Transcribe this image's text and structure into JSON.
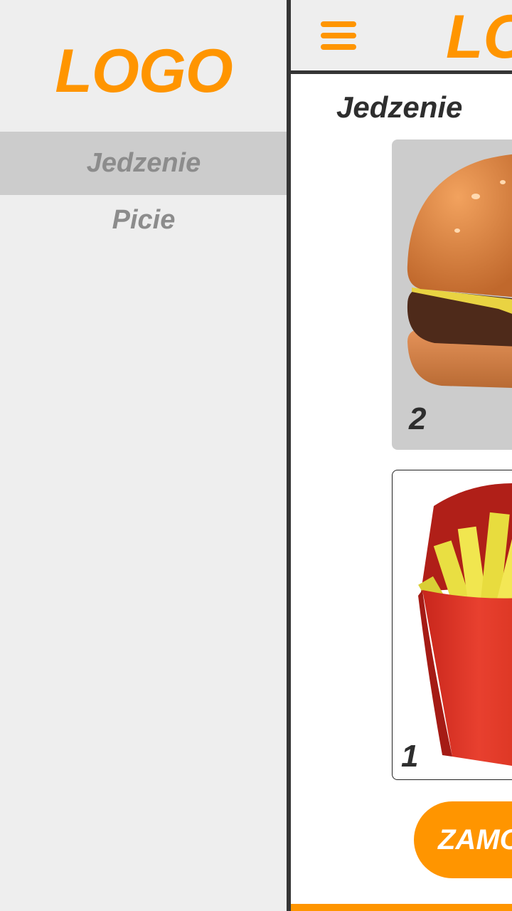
{
  "drawer": {
    "logo": "LOGO",
    "items": [
      {
        "label": "Jedzenie",
        "active": true
      },
      {
        "label": "Picie",
        "active": false
      }
    ]
  },
  "header": {
    "logo": "LO",
    "menu_icon": "hamburger-icon"
  },
  "main": {
    "section_title": "Jedzenie",
    "products": [
      {
        "image": "burger-image",
        "quantity": "2"
      },
      {
        "image": "fries-image",
        "quantity": "1"
      }
    ],
    "order_button": "ZAMO"
  },
  "colors": {
    "accent": "#ff9500",
    "text_dark": "#2e2e2e",
    "menu_text": "#8c8c8c",
    "active_item_bg": "#cccccc",
    "background": "#eeeeee"
  }
}
